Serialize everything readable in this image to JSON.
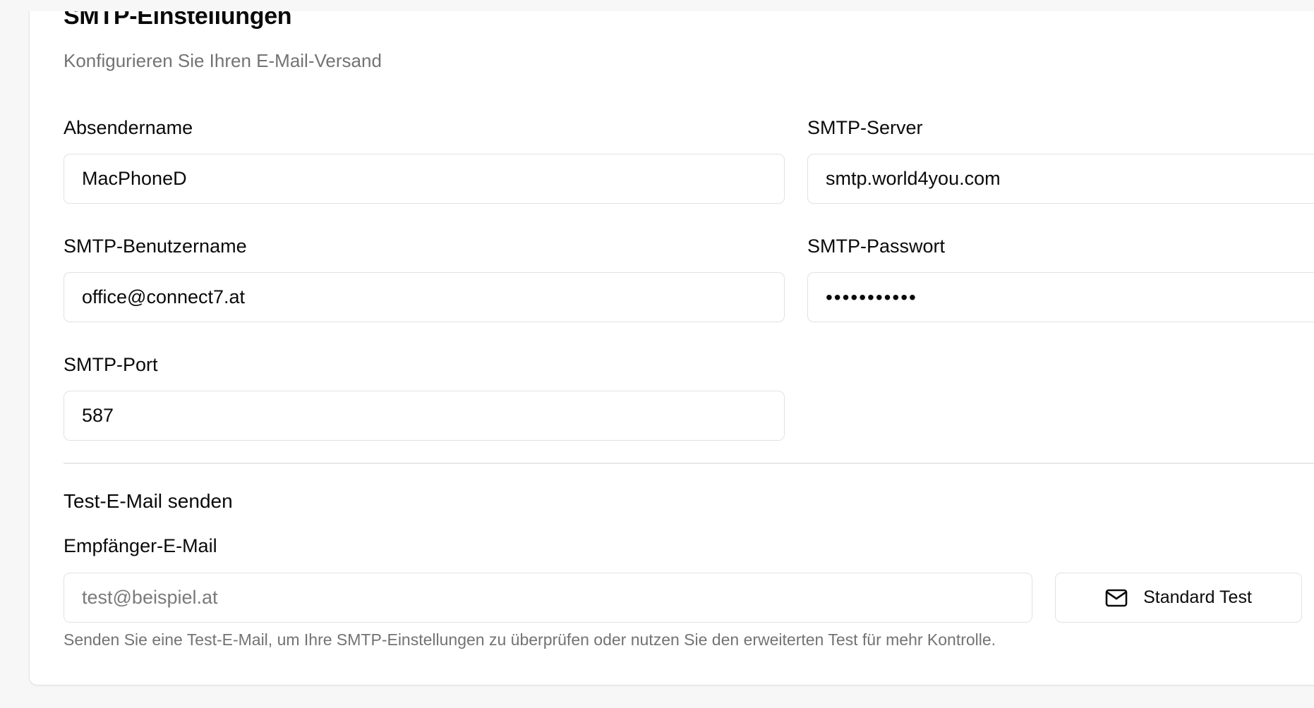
{
  "section": {
    "title": "SMTP-Einstellungen",
    "subtitle": "Konfigurieren Sie Ihren E-Mail-Versand"
  },
  "fields": {
    "sender_name": {
      "label": "Absendername",
      "value": "MacPhoneD"
    },
    "smtp_server": {
      "label": "SMTP-Server",
      "value": "smtp.world4you.com"
    },
    "smtp_username": {
      "label": "SMTP-Benutzername",
      "value": "office@connect7.at"
    },
    "smtp_password": {
      "label": "SMTP-Passwort",
      "value": "•••••••••••"
    },
    "smtp_port": {
      "label": "SMTP-Port",
      "value": "587"
    }
  },
  "test_email": {
    "title": "Test-E-Mail senden",
    "recipient_label": "Empfänger-E-Mail",
    "recipient_placeholder": "test@beispiel.at",
    "button_label": "Standard Test",
    "button_icon": "mail-icon",
    "helper_text": "Senden Sie eine Test-E-Mail, um Ihre SMTP-Einstellungen zu überprüfen oder nutzen Sie den erweiterten Test für mehr Kontrolle."
  }
}
